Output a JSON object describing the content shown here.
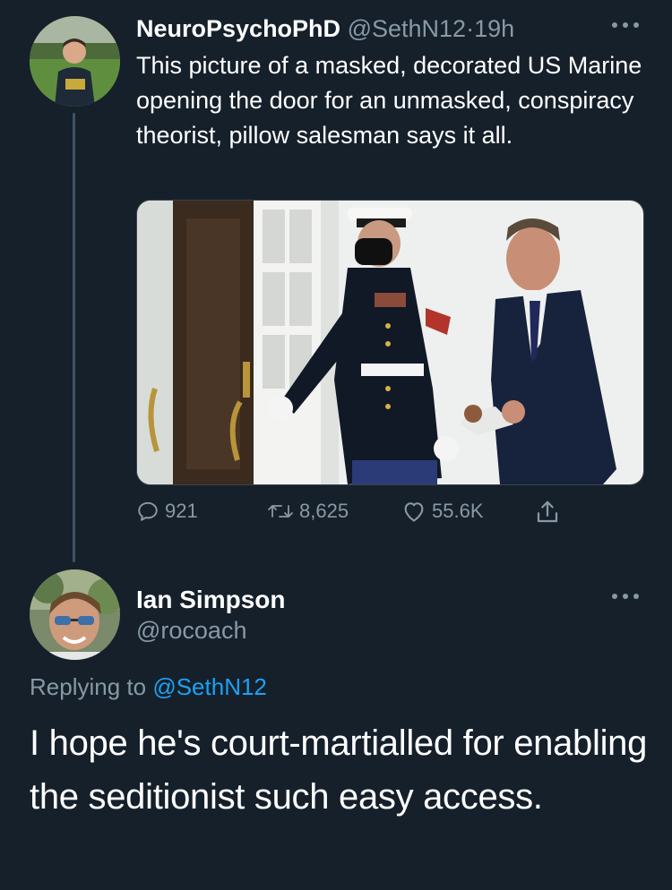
{
  "tweet": {
    "display_name": "NeuroPsychoPhD",
    "handle": "@SethN12",
    "separator": "·",
    "time": "19h",
    "text": "This picture of a masked, decorated US Marine opening the door for an unmasked, conspiracy theorist, pillow salesman says it all.",
    "actions": {
      "replies": "921",
      "retweets": "8,625",
      "likes": "55.6K"
    }
  },
  "reply": {
    "display_name": "Ian Simpson",
    "handle": "@rocoach",
    "replying_prefix": "Replying to",
    "replying_to": "@SethN12",
    "text": "I hope he's court-martialled for enabling the seditionist such easy access."
  },
  "icons": {
    "more": "more-horizontal-icon",
    "reply": "reply-icon",
    "retweet": "retweet-icon",
    "like": "heart-icon",
    "share": "share-icon"
  },
  "colors": {
    "background": "#15202b",
    "secondary_text": "#8899a6",
    "link": "#1da1f2",
    "thread_line": "#3d5466"
  }
}
